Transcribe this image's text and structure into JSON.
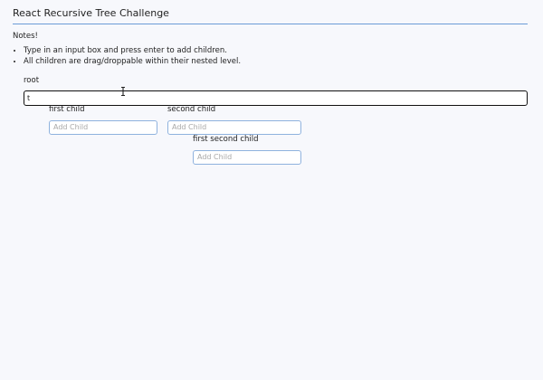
{
  "header": {
    "title": "React Recursive Tree Challenge"
  },
  "notes": {
    "heading": "Notes!",
    "items": [
      "Type in an input box and press enter to add children.",
      "All children are drag/droppable within their nested level."
    ]
  },
  "tree": {
    "root": {
      "label": "root",
      "input_value": "t"
    },
    "first_child": {
      "label": "first child",
      "placeholder": "Add Child"
    },
    "second_child": {
      "label": "second child",
      "placeholder": "Add Child"
    },
    "first_second_child": {
      "label": "first second child",
      "placeholder": "Add Child"
    }
  }
}
